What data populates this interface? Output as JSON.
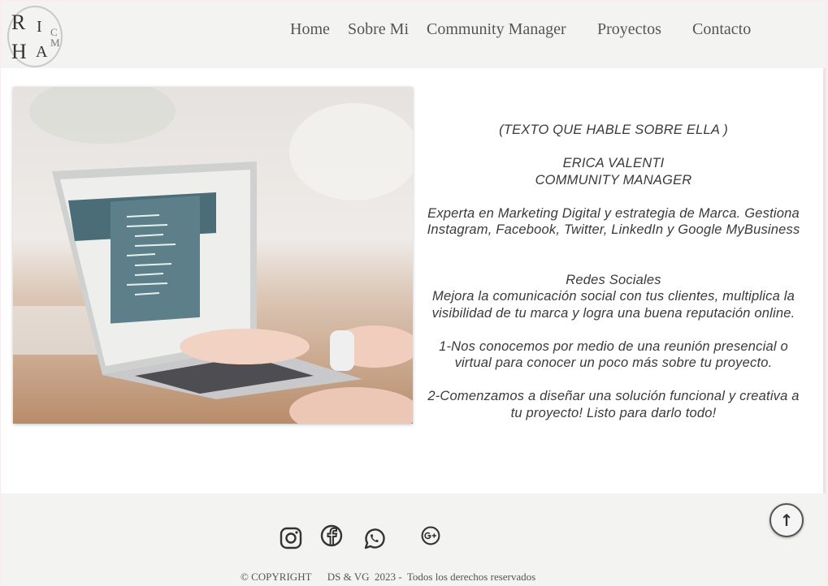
{
  "header": {
    "logo": {
      "letters": [
        "R",
        "I",
        "C",
        "H",
        "A",
        "M"
      ]
    },
    "nav": [
      "Home",
      "Sobre Mi",
      "Community Manager",
      "Proyectos",
      "Contacto"
    ]
  },
  "hero": {
    "image": "laptop-typing-photo"
  },
  "bio": {
    "lines": [
      "(TEXTO QUE HABLE SOBRE ELLA )",
      "",
      "ERICA VALENTI",
      "COMMUNITY MANAGER",
      "",
      "Experta en Marketing Digital y estrategia de Marca. Gestiona",
      "Instagram, Facebook, Twitter, LinkedIn y Google MyBusiness",
      "",
      "",
      "Redes Sociales",
      "Mejora la comunicación social con tus clientes, multiplica la",
      "visibilidad de tu marca y logra una buena reputación online.",
      "",
      "1-Nos conocemos por medio de una reunión presencial o",
      "virtual para conocer un poco más sobre tu proyecto.",
      "",
      "2-Comenzamos a diseñar una solución funcional y creativa a",
      "tu proyecto! Listo para darlo todo!"
    ]
  },
  "footer": {
    "social": [
      "instagram-icon",
      "facebook-icon",
      "whatsapp-icon",
      "google-plus-icon"
    ],
    "copyright": "© COPYRIGHT      DS & VG  2023 -  Todos los derechos reservados",
    "to_top": "↑"
  },
  "colors": {
    "header_bg": "#f3f3f2",
    "text": "#3a3a3a",
    "nav": "#555555"
  }
}
